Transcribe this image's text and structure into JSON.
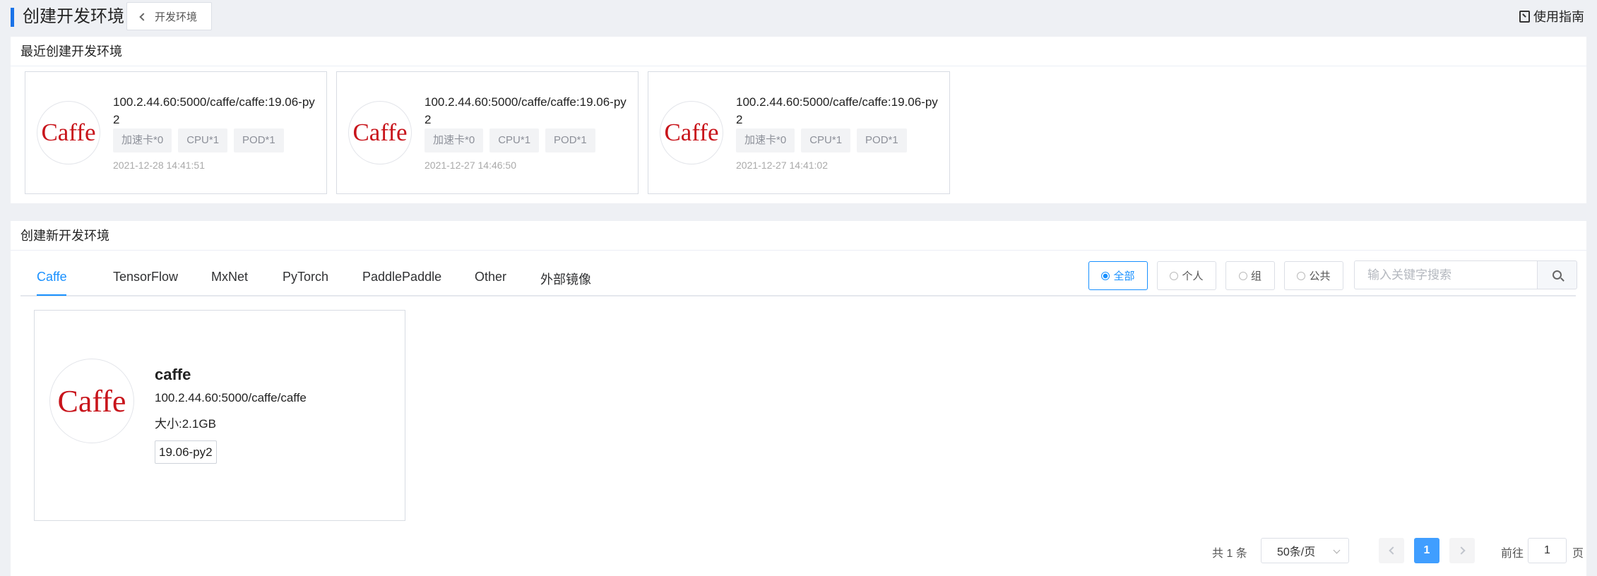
{
  "header": {
    "title": "创建开发环境",
    "back_label": "开发环境",
    "guide_label": "使用指南"
  },
  "recent": {
    "title": "最近创建开发环境",
    "cards": [
      {
        "logo": "Caffe",
        "image": "100.2.44.60:5000/caffe/caffe:19.06-py2",
        "tags": [
          "加速卡*0",
          "CPU*1",
          "POD*1"
        ],
        "time": "2021-12-28 14:41:51"
      },
      {
        "logo": "Caffe",
        "image": "100.2.44.60:5000/caffe/caffe:19.06-py2",
        "tags": [
          "加速卡*0",
          "CPU*1",
          "POD*1"
        ],
        "time": "2021-12-27 14:46:50"
      },
      {
        "logo": "Caffe",
        "image": "100.2.44.60:5000/caffe/caffe:19.06-py2",
        "tags": [
          "加速卡*0",
          "CPU*1",
          "POD*1"
        ],
        "time": "2021-12-27 14:41:02"
      }
    ]
  },
  "create": {
    "title": "创建新开发环境",
    "tabs": [
      "Caffe",
      "TensorFlow",
      "MxNet",
      "PyTorch",
      "PaddlePaddle",
      "Other",
      "外部镜像"
    ],
    "active_tab": "Caffe",
    "filters": [
      "全部",
      "个人",
      "组",
      "公共"
    ],
    "active_filter": "全部",
    "search_placeholder": "输入关键字搜索",
    "env": {
      "logo": "Caffe",
      "name": "caffe",
      "path": "100.2.44.60:5000/caffe/caffe",
      "size": "大小:2.1GB",
      "tag": "19.06-py2"
    }
  },
  "pagination": {
    "total": "共 1 条",
    "page_size": "50条/页",
    "current_page": "1",
    "goto_prefix": "前往",
    "goto_value": "1",
    "goto_suffix": "页"
  },
  "colors": {
    "accent": "#1890ff",
    "logo_red": "#c8141b",
    "title_bar": "#1a73e8"
  }
}
